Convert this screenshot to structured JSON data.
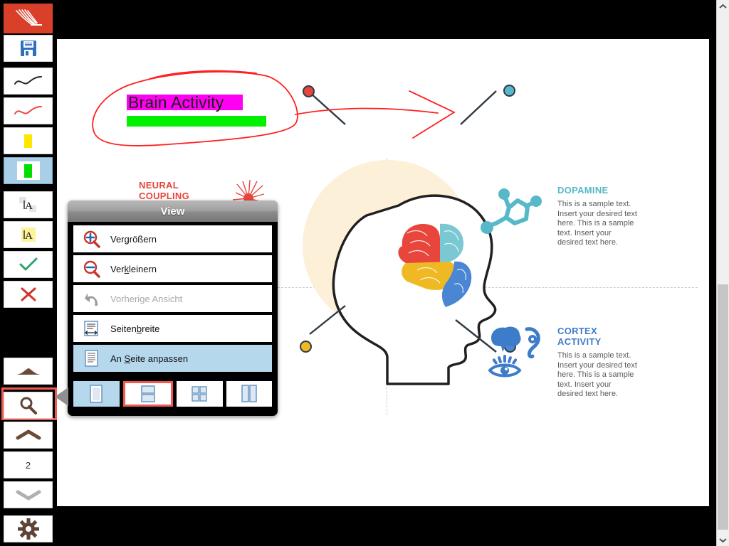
{
  "app": {
    "logo_icon": "quill-pen-icon"
  },
  "toolbar": {
    "items": [
      {
        "name": "logo",
        "icon": "quill-pen-icon",
        "label": "",
        "selected": false
      },
      {
        "name": "save",
        "icon": "floppy-disk-icon",
        "label": "",
        "selected": false
      },
      {
        "name": "pen-black",
        "icon": "black-pen-stroke-icon",
        "label": "",
        "selected": false
      },
      {
        "name": "pen-red",
        "icon": "red-pen-stroke-icon",
        "label": "",
        "selected": false
      },
      {
        "name": "highlight-yellow",
        "icon": "yellow-marker-icon",
        "label": "",
        "selected": false
      },
      {
        "name": "highlight-green",
        "icon": "green-marker-icon",
        "label": "",
        "selected": true
      },
      {
        "name": "erase-text",
        "icon": "erase-text-icon",
        "label": "",
        "selected": false
      },
      {
        "name": "highlight-text",
        "icon": "highlight-text-icon",
        "label": "",
        "selected": false
      },
      {
        "name": "accept",
        "icon": "green-check-icon",
        "label": "",
        "selected": false
      },
      {
        "name": "reject",
        "icon": "red-cross-icon",
        "label": "",
        "selected": false
      },
      {
        "name": "page-top",
        "icon": "triangle-up-icon",
        "label": "",
        "selected": false
      },
      {
        "name": "zoom",
        "icon": "magnifier-icon",
        "label": "",
        "selected": false
      },
      {
        "name": "page-up",
        "icon": "chevron-up-icon",
        "label": "",
        "selected": false
      },
      {
        "name": "page-number",
        "icon": "",
        "label": "2",
        "selected": false
      },
      {
        "name": "page-down",
        "icon": "chevron-down-icon",
        "label": "",
        "selected": false
      },
      {
        "name": "settings",
        "icon": "gear-icon",
        "label": "",
        "selected": false
      }
    ],
    "page_number": "2"
  },
  "dialog": {
    "title": "View",
    "menu_items": [
      {
        "label": "Vergrößern",
        "accel": "g",
        "icon": "zoom-in-icon",
        "state": "normal"
      },
      {
        "label": "Verkleinern",
        "accel": "k",
        "icon": "zoom-out-icon",
        "state": "normal"
      },
      {
        "label": "Vorherige Ansicht",
        "accel": "",
        "icon": "undo-arrow-icon",
        "state": "disabled"
      },
      {
        "label": "Seitenbreite",
        "accel": "b",
        "icon": "page-width-icon",
        "state": "normal"
      },
      {
        "label": "An Seite anpassen",
        "accel": "S",
        "icon": "fit-page-icon",
        "state": "selected"
      }
    ],
    "layout_buttons": [
      {
        "name": "single-page-layout",
        "icon": "single-page-icon",
        "state": "selected"
      },
      {
        "name": "two-row-layout",
        "icon": "two-row-page-icon",
        "state": "focused"
      },
      {
        "name": "grid-layout",
        "icon": "grid-page-icon",
        "state": "normal"
      },
      {
        "name": "two-column-layout",
        "icon": "two-column-icon",
        "state": "normal"
      }
    ]
  },
  "annotations": {
    "title": "Brain Activity",
    "highlight_color": "#ff00f2",
    "underline_color": "#00f000",
    "ink_color": "#ff2020"
  },
  "document": {
    "sections": [
      {
        "name": "neural-coupling",
        "title": "NEURAL COUPLING",
        "color": "#e8453c",
        "icon": "neuron-icon",
        "body": ""
      },
      {
        "name": "dopamine",
        "title": "DOPAMINE",
        "color": "#56b8c8",
        "icon": "molecule-icon",
        "body": "This is a sample text. Insert your desired text here. This is a sample text. Insert your desired text here."
      },
      {
        "name": "cortex-activity",
        "title": "CORTEX ACTIVITY",
        "color": "#3d7cc9",
        "icon": "senses-icon",
        "body": "This is a sample text. Insert your desired text here. This is a sample text. Insert your desired text here."
      }
    ],
    "brain_colors": {
      "frontal": "#e8453c",
      "parietal": "#79c8d2",
      "temporal": "#efb924",
      "occipital": "#4a86d4",
      "halo": "#fdf0d8"
    },
    "connector_dots": [
      {
        "name": "dot-red",
        "color": "#e8453c"
      },
      {
        "name": "dot-teal",
        "color": "#56b8c8"
      },
      {
        "name": "dot-yellow",
        "color": "#efb924"
      },
      {
        "name": "dot-blue",
        "color": "#4a86d4"
      }
    ]
  },
  "scrollbar": {
    "up_icon": "chevron-up-icon",
    "down_icon": "chevron-down-icon"
  }
}
